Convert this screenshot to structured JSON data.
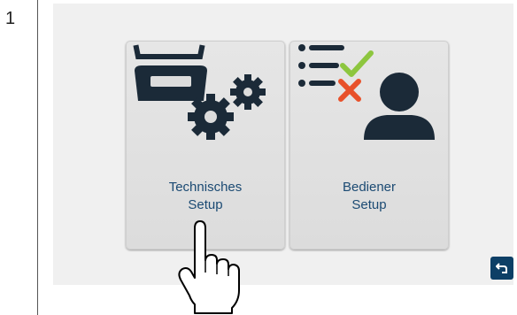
{
  "step": {
    "number": "1"
  },
  "tiles": [
    {
      "id": "technical-setup",
      "label_line1": "Technisches",
      "label_line2": "Setup",
      "icon": "scale-gears-icon"
    },
    {
      "id": "operator-setup",
      "label_line1": "Bediener",
      "label_line2": "Setup",
      "icon": "user-checklist-icon"
    }
  ],
  "back_button": {
    "icon": "back-arrow-icon"
  },
  "pointer": {
    "icon": "pointing-hand-icon"
  },
  "colors": {
    "icon_dark": "#1b2a38",
    "label_blue": "#1b4a73",
    "check_green": "#8dc63f",
    "cross_orange": "#e8512a",
    "back_button_bg": "#0d3f66"
  }
}
